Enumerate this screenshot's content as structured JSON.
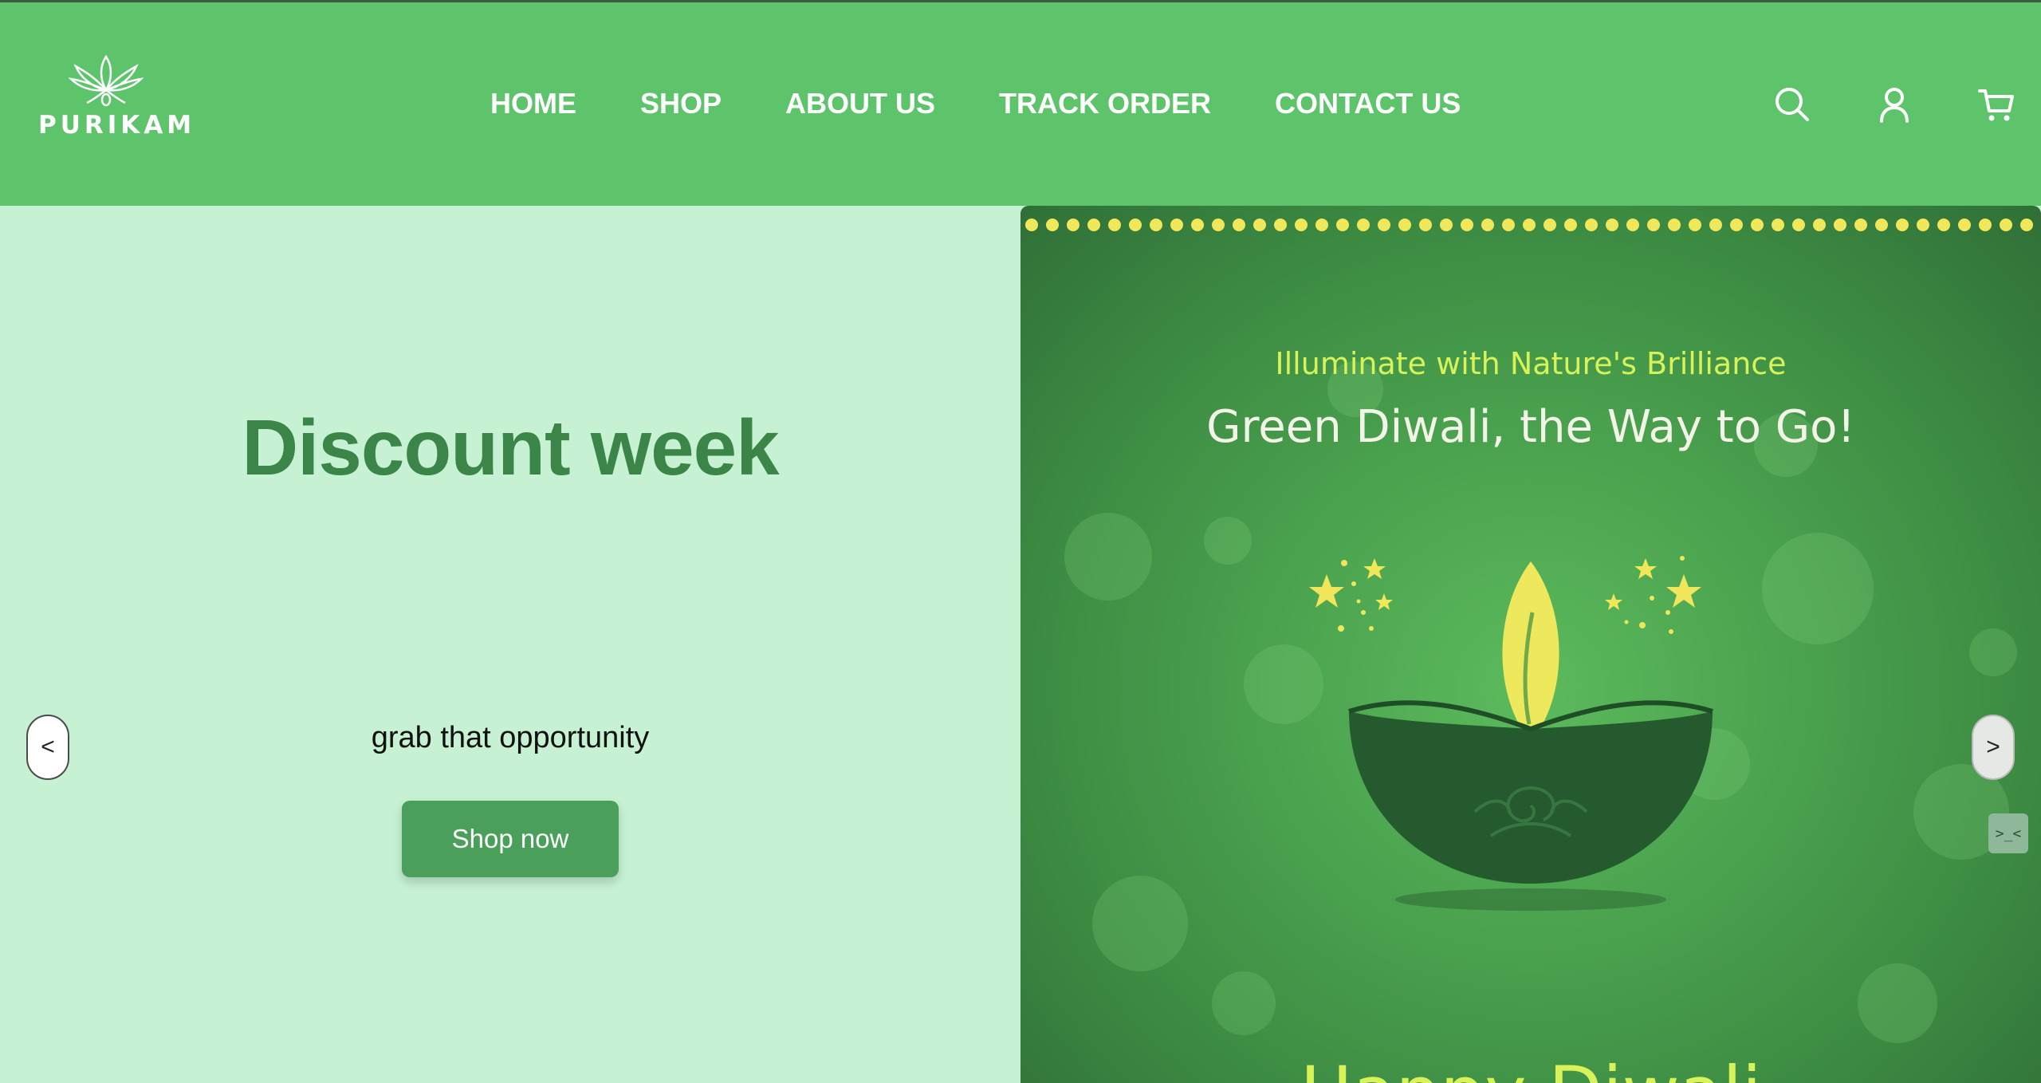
{
  "brand": {
    "name": "PURIKAM",
    "primary_color": "#5ec46b",
    "hero_bg": "#c6f2d3",
    "accent_text": "#3a8547",
    "button_color": "#4aa05a"
  },
  "nav": {
    "items": [
      {
        "label": "HOME"
      },
      {
        "label": "SHOP"
      },
      {
        "label": "ABOUT US"
      },
      {
        "label": "TRACK ORDER"
      },
      {
        "label": "CONTACT US"
      }
    ]
  },
  "header_icons": [
    "search-icon",
    "user-icon",
    "cart-icon"
  ],
  "hero": {
    "title": "Discount week",
    "subtitle": "grab that opportunity",
    "cta_label": "Shop now",
    "prev_label": "<",
    "next_label": ">"
  },
  "banner": {
    "tagline": "Illuminate with Nature's Brilliance",
    "title": "Green Diwali, the Way to Go!",
    "bottom_text": "Happy Diwali"
  },
  "dev_tab": {
    "label": ">_<"
  }
}
